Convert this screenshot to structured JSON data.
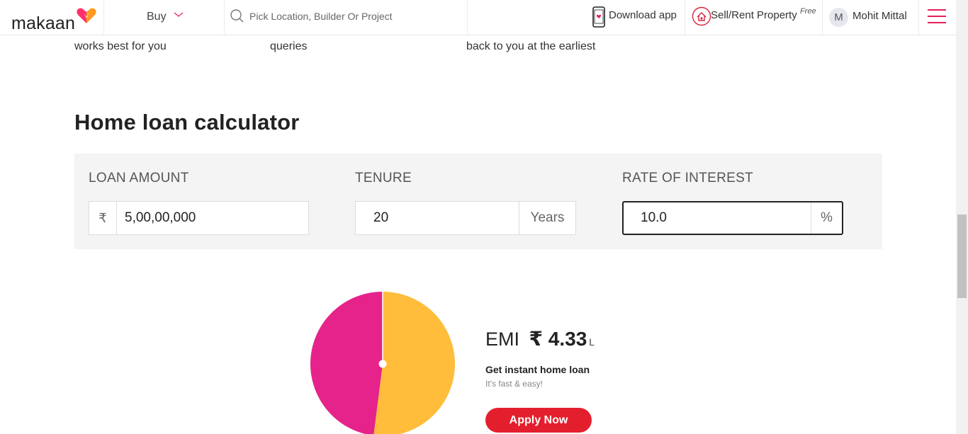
{
  "header": {
    "logo_text": "makaan",
    "buy_label": "Buy",
    "search_placeholder": "Pick Location, Builder Or Project",
    "download_label": "Download app",
    "sell_label": "Sell/Rent Property",
    "sell_badge": "Free",
    "user_initial": "M",
    "user_name": "Mohit Mittal"
  },
  "steps": [
    {
      "text": "works best for you"
    },
    {
      "text": "queries"
    },
    {
      "text": "back to you at the earliest"
    }
  ],
  "calculator": {
    "title": "Home loan calculator",
    "loan_amount": {
      "label": "LOAN AMOUNT",
      "prefix": "₹",
      "value": "5,00,00,000"
    },
    "tenure": {
      "label": "TENURE",
      "value": "20",
      "suffix": "Years"
    },
    "rate": {
      "label": "RATE OF INTEREST",
      "value": "10.0",
      "suffix": "%"
    }
  },
  "result": {
    "emi_label": "EMI",
    "emi_currency": "₹",
    "emi_value": "4.33",
    "emi_unit": "L",
    "loan_heading": "Get instant home loan",
    "loan_sub": "It's fast & easy!",
    "apply_label": "Apply Now"
  },
  "pie": {
    "principal_share": 0.48,
    "colors": {
      "principal": "#e6238a",
      "interest": "#ffbd3b"
    }
  },
  "colors": {
    "accent": "#e41f5a",
    "button": "#e41f2d"
  }
}
